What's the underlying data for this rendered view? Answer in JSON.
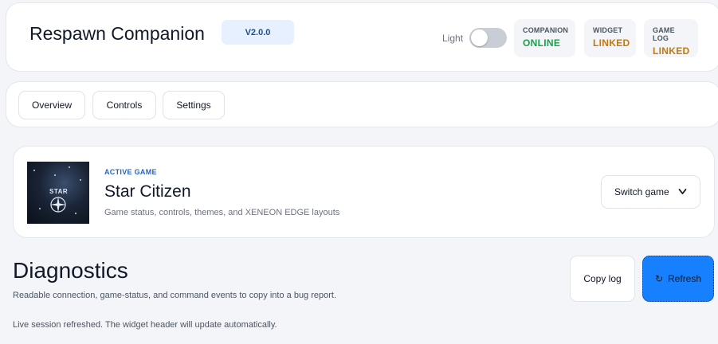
{
  "header": {
    "app_title": "Respawn Companion",
    "version": "V2.0.0",
    "theme_label": "Light",
    "statuses": [
      {
        "label": "COMPANION",
        "value": "ONLINE",
        "color": "#16a34a"
      },
      {
        "label": "WIDGET",
        "value": "LINKED",
        "color": "#c2790e"
      },
      {
        "label": "GAME LOG",
        "value": "LINKED",
        "color": "#c2790e"
      }
    ]
  },
  "nav": {
    "tabs": [
      {
        "label": "Overview"
      },
      {
        "label": "Controls"
      },
      {
        "label": "Settings"
      }
    ]
  },
  "active_game": {
    "section_label": "ACTIVE GAME",
    "title": "Star Citizen",
    "description": "Game status, controls, themes, and XENEON EDGE layouts",
    "thumbnail_text": "STAR",
    "switch_label": "Switch game",
    "switch_icon": "chevron-down-icon"
  },
  "diagnostics": {
    "title": "Diagnostics",
    "subtitle": "Readable connection, game-status, and command events to copy into a bug report.",
    "status_message": "Live session refreshed. The widget header will update automatically.",
    "copy_label": "Copy log",
    "refresh_label": "Refresh",
    "refresh_icon_glyph": "↻"
  },
  "colors": {
    "accent": "#1680ff",
    "badge_bg": "#e6f0ff"
  }
}
